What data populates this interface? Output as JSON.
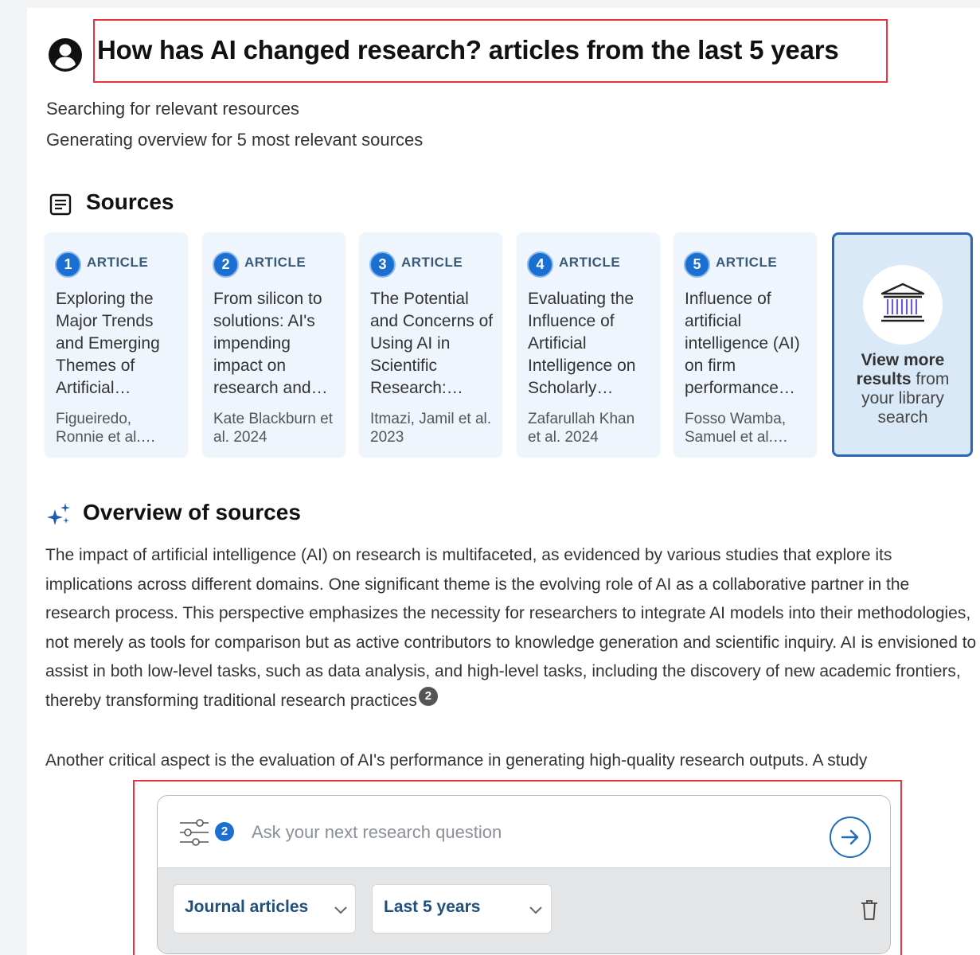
{
  "question": {
    "title": "How has AI changed research? articles from the last 5 years"
  },
  "status": [
    "Searching for relevant resources",
    "Generating overview for 5 most relevant sources"
  ],
  "sources": {
    "heading": "Sources",
    "cards": [
      {
        "number": "1",
        "type": "ARTICLE",
        "title": "Exploring the Major Trends and Emerging Themes of Artificial…",
        "authors": "Figueiredo, Ronnie et al.…"
      },
      {
        "number": "2",
        "type": "ARTICLE",
        "title": "From silicon to solutions: AI's impending impact on research and…",
        "authors": "Kate Blackburn et al. 2024"
      },
      {
        "number": "3",
        "type": "ARTICLE",
        "title": "The Potential and Concerns of Using AI in Scientific Research:…",
        "authors": "Itmazi, Jamil et al. 2023"
      },
      {
        "number": "4",
        "type": "ARTICLE",
        "title": "Evaluating the Influence of Artificial Intelligence on Scholarly…",
        "authors": "Zafarullah Khan et al. 2024"
      },
      {
        "number": "5",
        "type": "ARTICLE",
        "title": "Influence of artificial intelligence (AI) on firm performance…",
        "authors": "Fosso Wamba, Samuel et al.…"
      }
    ],
    "more": {
      "bold": "View more results",
      "rest": " from your library search"
    }
  },
  "overview": {
    "heading": "Overview of sources",
    "paragraph1": "The impact of artificial intelligence (AI) on research is multifaceted, as evidenced by various studies that explore its implications across different domains. One significant theme is the evolving role of AI as a collaborative partner in the research process. This perspective emphasizes the necessity for researchers to integrate AI models into their methodologies, not merely as tools for comparison but as active contributors to knowledge generation and scientific inquiry. AI is envisioned to assist in both low-level tasks, such as data analysis, and high-level tasks, including the discovery of new academic frontiers, thereby transforming traditional research practices",
    "paragraph1_citation": "2",
    "paragraph2": "Another critical aspect is the evaluation of AI's performance in generating high-quality research outputs. A study"
  },
  "query": {
    "placeholder": "Ask your next research question",
    "filter_count": "2",
    "content_type": "Journal articles",
    "date_range": "Last 5 years"
  },
  "icons": {
    "user": "user-circle-icon",
    "sources": "document-list-icon",
    "overview": "sparkle-icon",
    "filter": "sliders-icon",
    "submit": "arrow-right-circle-icon",
    "library": "library-building-icon",
    "delete": "trash-icon"
  },
  "colors": {
    "accent": "#1b6fd0",
    "highlight_border": "#e8323c",
    "card_bg": "#eef5fc",
    "more_card_border": "#2b67b7"
  }
}
